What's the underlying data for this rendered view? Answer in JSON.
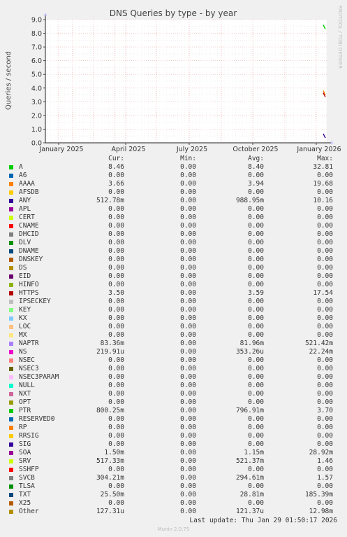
{
  "chart_data": {
    "type": "line",
    "title": "DNS Queries by type - by year",
    "ylabel": "Queries / second",
    "watermark": "RRDTOOL / TOBI OETIKER",
    "ylim": [
      0,
      9
    ],
    "yticks": [
      "0.0",
      "1.0",
      "2.0",
      "3.0",
      "4.0",
      "5.0",
      "6.0",
      "7.0",
      "8.0",
      "9.0"
    ],
    "xticks": [
      "January 2025",
      "April 2025",
      "July 2025",
      "October 2025",
      "January 2026"
    ],
    "grid": true,
    "series_end_values": [
      {
        "name": "A",
        "value": 8.46
      },
      {
        "name": "AAAA",
        "value": 3.66
      },
      {
        "name": "HTTPS",
        "value": 3.5
      },
      {
        "name": "ANY",
        "value": 0.51
      }
    ]
  },
  "legend": {
    "headers": {
      "cur": "Cur:",
      "min": "Min:",
      "avg": "Avg:",
      "max": "Max:"
    },
    "rows": [
      {
        "name": "A",
        "color": "#00cc00",
        "cur": "8.46",
        "min": "0.00",
        "avg": "8.40",
        "max": "32.81"
      },
      {
        "name": "A6",
        "color": "#0066b3",
        "cur": "0.00",
        "min": "0.00",
        "avg": "0.00",
        "max": "0.00"
      },
      {
        "name": "AAAA",
        "color": "#ff8000",
        "cur": "3.66",
        "min": "0.00",
        "avg": "3.94",
        "max": "19.68"
      },
      {
        "name": "AFSDB",
        "color": "#ffcc00",
        "cur": "0.00",
        "min": "0.00",
        "avg": "0.00",
        "max": "0.00"
      },
      {
        "name": "ANY",
        "color": "#330099",
        "cur": "512.78m",
        "min": "0.00",
        "avg": "988.95m",
        "max": "10.16"
      },
      {
        "name": "APL",
        "color": "#990099",
        "cur": "0.00",
        "min": "0.00",
        "avg": "0.00",
        "max": "0.00"
      },
      {
        "name": "CERT",
        "color": "#ccff00",
        "cur": "0.00",
        "min": "0.00",
        "avg": "0.00",
        "max": "0.00"
      },
      {
        "name": "CNAME",
        "color": "#ff0000",
        "cur": "0.00",
        "min": "0.00",
        "avg": "0.00",
        "max": "0.00"
      },
      {
        "name": "DHCID",
        "color": "#808080",
        "cur": "0.00",
        "min": "0.00",
        "avg": "0.00",
        "max": "0.00"
      },
      {
        "name": "DLV",
        "color": "#008f00",
        "cur": "0.00",
        "min": "0.00",
        "avg": "0.00",
        "max": "0.00"
      },
      {
        "name": "DNAME",
        "color": "#00487d",
        "cur": "0.00",
        "min": "0.00",
        "avg": "0.00",
        "max": "0.00"
      },
      {
        "name": "DNSKEY",
        "color": "#b35a00",
        "cur": "0.00",
        "min": "0.00",
        "avg": "0.00",
        "max": "0.00"
      },
      {
        "name": "DS",
        "color": "#b38f00",
        "cur": "0.00",
        "min": "0.00",
        "avg": "0.00",
        "max": "0.00"
      },
      {
        "name": "EID",
        "color": "#6b006b",
        "cur": "0.00",
        "min": "0.00",
        "avg": "0.00",
        "max": "0.00"
      },
      {
        "name": "HINFO",
        "color": "#8fb300",
        "cur": "0.00",
        "min": "0.00",
        "avg": "0.00",
        "max": "0.00"
      },
      {
        "name": "HTTPS",
        "color": "#b30000",
        "cur": "3.50",
        "min": "0.00",
        "avg": "3.59",
        "max": "17.54"
      },
      {
        "name": "IPSECKEY",
        "color": "#bebebe",
        "cur": "0.00",
        "min": "0.00",
        "avg": "0.00",
        "max": "0.00"
      },
      {
        "name": "KEY",
        "color": "#80ff80",
        "cur": "0.00",
        "min": "0.00",
        "avg": "0.00",
        "max": "0.00"
      },
      {
        "name": "KX",
        "color": "#80c9ff",
        "cur": "0.00",
        "min": "0.00",
        "avg": "0.00",
        "max": "0.00"
      },
      {
        "name": "LOC",
        "color": "#ffc080",
        "cur": "0.00",
        "min": "0.00",
        "avg": "0.00",
        "max": "0.00"
      },
      {
        "name": "MX",
        "color": "#ffe680",
        "cur": "0.00",
        "min": "0.00",
        "avg": "0.00",
        "max": "0.00"
      },
      {
        "name": "NAPTR",
        "color": "#aa80ff",
        "cur": "83.36m",
        "min": "0.00",
        "avg": "81.96m",
        "max": "521.42m"
      },
      {
        "name": "NS",
        "color": "#ee00cc",
        "cur": "219.91u",
        "min": "0.00",
        "avg": "353.26u",
        "max": "22.24m"
      },
      {
        "name": "NSEC",
        "color": "#ff8080",
        "cur": "0.00",
        "min": "0.00",
        "avg": "0.00",
        "max": "0.00"
      },
      {
        "name": "NSEC3",
        "color": "#666600",
        "cur": "0.00",
        "min": "0.00",
        "avg": "0.00",
        "max": "0.00"
      },
      {
        "name": "NSEC3PARAM",
        "color": "#ffbbff",
        "cur": "0.00",
        "min": "0.00",
        "avg": "0.00",
        "max": "0.00"
      },
      {
        "name": "NULL",
        "color": "#00ffcc",
        "cur": "0.00",
        "min": "0.00",
        "avg": "0.00",
        "max": "0.00"
      },
      {
        "name": "NXT",
        "color": "#cc6699",
        "cur": "0.00",
        "min": "0.00",
        "avg": "0.00",
        "max": "0.00"
      },
      {
        "name": "OPT",
        "color": "#999900",
        "cur": "0.00",
        "min": "0.00",
        "avg": "0.00",
        "max": "0.00"
      },
      {
        "name": "PTR",
        "color": "#00cc00",
        "cur": "800.25m",
        "min": "0.00",
        "avg": "796.91m",
        "max": "3.70"
      },
      {
        "name": "RESERVED0",
        "color": "#0066b3",
        "cur": "0.00",
        "min": "0.00",
        "avg": "0.00",
        "max": "0.00"
      },
      {
        "name": "RP",
        "color": "#ff8000",
        "cur": "0.00",
        "min": "0.00",
        "avg": "0.00",
        "max": "0.00"
      },
      {
        "name": "RRSIG",
        "color": "#ffcc00",
        "cur": "0.00",
        "min": "0.00",
        "avg": "0.00",
        "max": "0.00"
      },
      {
        "name": "SIG",
        "color": "#330099",
        "cur": "0.00",
        "min": "0.00",
        "avg": "0.00",
        "max": "0.00"
      },
      {
        "name": "SOA",
        "color": "#990099",
        "cur": "1.50m",
        "min": "0.00",
        "avg": "1.15m",
        "max": "28.92m"
      },
      {
        "name": "SRV",
        "color": "#ccff00",
        "cur": "517.33m",
        "min": "0.00",
        "avg": "521.37m",
        "max": "1.46"
      },
      {
        "name": "SSHFP",
        "color": "#ff0000",
        "cur": "0.00",
        "min": "0.00",
        "avg": "0.00",
        "max": "0.00"
      },
      {
        "name": "SVCB",
        "color": "#808080",
        "cur": "304.21m",
        "min": "0.00",
        "avg": "294.61m",
        "max": "1.57"
      },
      {
        "name": "TLSA",
        "color": "#008f00",
        "cur": "0.00",
        "min": "0.00",
        "avg": "0.00",
        "max": "0.00"
      },
      {
        "name": "TXT",
        "color": "#00487d",
        "cur": "25.50m",
        "min": "0.00",
        "avg": "28.81m",
        "max": "185.39m"
      },
      {
        "name": "X25",
        "color": "#b35a00",
        "cur": "0.00",
        "min": "0.00",
        "avg": "0.00",
        "max": "0.00"
      },
      {
        "name": "Other",
        "color": "#b38f00",
        "cur": "127.31u",
        "min": "0.00",
        "avg": "121.37u",
        "max": "12.98m"
      }
    ]
  },
  "footer": {
    "last_update": "Last update: Thu Jan 29 01:50:17 2026",
    "version": "Munin 2.0.75"
  }
}
